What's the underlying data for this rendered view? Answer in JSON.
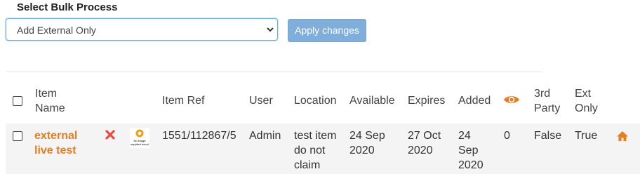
{
  "bulk": {
    "title": "Select Bulk Process",
    "selected": "Add External Only",
    "apply_label": "Apply changes"
  },
  "table": {
    "headers": {
      "item_name": [
        "Item",
        "Name"
      ],
      "item_ref": "Item Ref",
      "user": "User",
      "location": "Location",
      "available": "Available",
      "expires": "Expires",
      "added": "Added",
      "views_icon": "eye-icon",
      "third_party": [
        "3rd",
        "Party"
      ],
      "ext_only": [
        "Ext",
        "Only"
      ]
    },
    "rows": [
      {
        "name": [
          "external",
          "live test"
        ],
        "thumb_text": [
          "No image",
          "supplied sorry!"
        ],
        "ref": "1551/112867/5",
        "user": "Admin",
        "location": [
          "test item",
          "do not",
          "claim"
        ],
        "available": [
          "24 Sep",
          "2020"
        ],
        "expires": [
          "27 Oct",
          "2020"
        ],
        "added": [
          "24",
          "Sep",
          "2020"
        ],
        "views": "0",
        "third_party": "False",
        "ext_only": "True"
      }
    ]
  },
  "colors": {
    "accent": "#e67e22",
    "button": "#80aedb",
    "delete": "#e74c3c",
    "focus": "#66afe9"
  }
}
